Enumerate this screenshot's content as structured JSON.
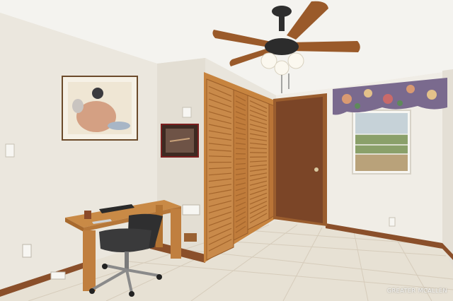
{
  "scene": {
    "description_items": [
      "ceiling-fan",
      "framed-artwork",
      "small-framed-picture",
      "louvered-closet-doors",
      "wooden-entry-door",
      "floral-valance",
      "window",
      "wooden-desk",
      "office-chair",
      "tile-floor"
    ]
  },
  "watermark": {
    "text": "GREATER MCALLEN"
  },
  "colors": {
    "wall": "#ece8df",
    "ceiling": "#f3f2ee",
    "floor": "#e6dfd2",
    "wood": "#b9773b",
    "door": "#7a4526",
    "baseboard": "#8a4f2a"
  }
}
